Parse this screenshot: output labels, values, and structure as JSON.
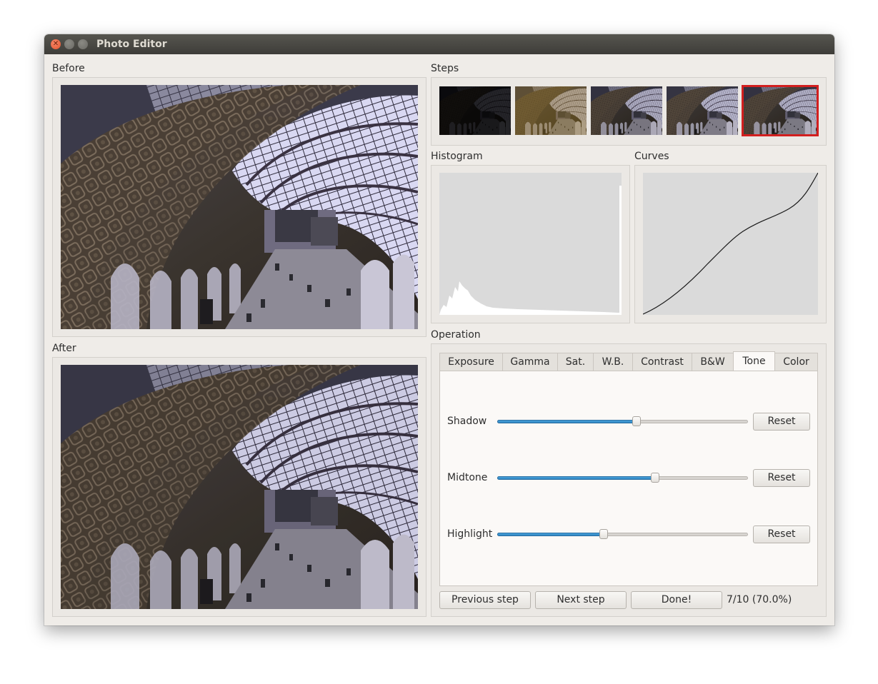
{
  "window": {
    "title": "Photo Editor"
  },
  "before": {
    "label": "Before"
  },
  "after": {
    "label": "After"
  },
  "steps": {
    "label": "Steps",
    "count": 5,
    "selected_index": 4
  },
  "histogram": {
    "label": "Histogram"
  },
  "curves": {
    "label": "Curves"
  },
  "operation": {
    "label": "Operation",
    "tabs": [
      "Exposure",
      "Gamma",
      "Sat.",
      "W.B.",
      "Contrast",
      "B&W",
      "Tone",
      "Color"
    ],
    "active_tab": "Tone",
    "sliders": [
      {
        "label": "Shadow",
        "value": 0.555,
        "reset_label": "Reset"
      },
      {
        "label": "Midtone",
        "value": 0.63,
        "reset_label": "Reset"
      },
      {
        "label": "Highlight",
        "value": 0.425,
        "reset_label": "Reset"
      }
    ]
  },
  "footer": {
    "previous_label": "Previous step",
    "next_label": "Next step",
    "done_label": "Done!",
    "progress_text": "7/10 (70.0%)"
  },
  "colors": {
    "accent": "#3a8fd0",
    "selected_step": "#d21f1f",
    "titlebar": "#4a4944"
  }
}
